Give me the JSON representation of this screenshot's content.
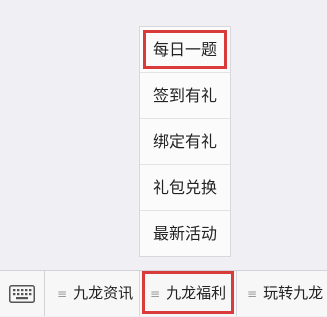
{
  "popup_menu": {
    "items": [
      {
        "label": "每日一题",
        "highlighted": true
      },
      {
        "label": "签到有礼"
      },
      {
        "label": "绑定有礼"
      },
      {
        "label": "礼包兑换"
      },
      {
        "label": "最新活动"
      }
    ]
  },
  "bottom_menu": {
    "keyboard_icon": "keyboard-icon",
    "tabs": [
      {
        "label": "九龙资讯",
        "icon": "menu-lines-icon"
      },
      {
        "label": "九龙福利",
        "icon": "menu-lines-icon",
        "highlighted": true
      },
      {
        "label": "玩转九龙",
        "icon": "menu-lines-icon"
      }
    ]
  },
  "colors": {
    "highlight": "#d93a3a",
    "background": "#efeff4"
  }
}
